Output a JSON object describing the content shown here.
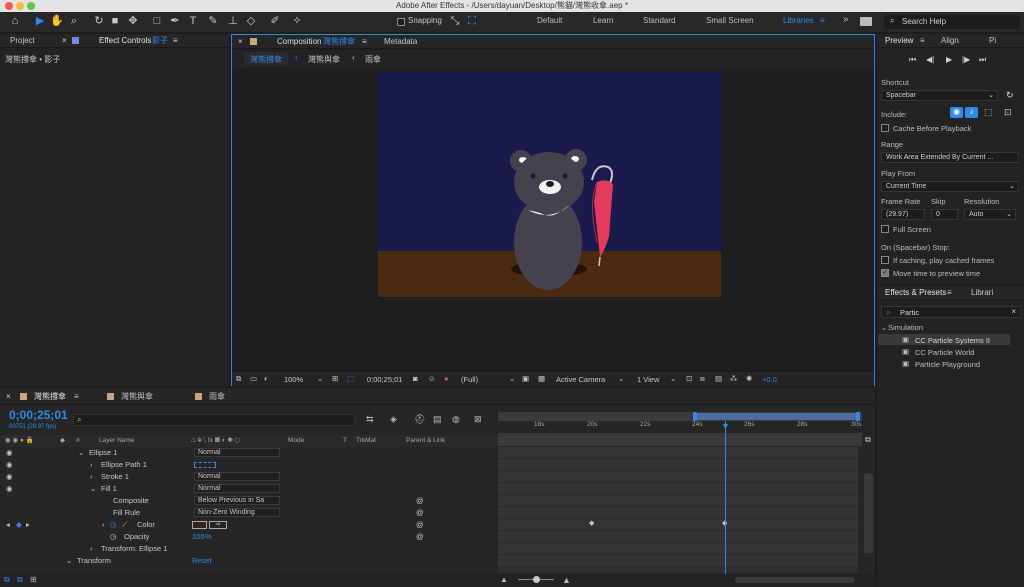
{
  "app": {
    "title": "Adobe After Effects - /Users/dayuan/Desktop/熊貓/灣熊收傘.aep *"
  },
  "toolbar": {
    "snapping_label": "Snapping",
    "workspaces": [
      "Default",
      "Learn",
      "Standard",
      "Small Screen",
      "Libraries"
    ],
    "active_workspace": "Libraries",
    "search_placeholder": "Search Help"
  },
  "left_panel": {
    "tab_project": "Project",
    "tab_effect_controls": "Effect Controls",
    "effect_controls_layer": "影子",
    "layer_path": "灣熊撐傘 • 影子"
  },
  "composition": {
    "tab_label": "Composition",
    "comp_name": "灣熊撐傘",
    "tab_metadata": "Metadata",
    "breadcrumbs": [
      "灣熊撐傘",
      "灣熊與傘",
      "雨傘"
    ],
    "footer": {
      "zoom": "100%",
      "timecode": "0;00;25;01",
      "resolution": "(Full)",
      "camera": "Active Camera",
      "view": "1 View",
      "exposure": "+0.0"
    }
  },
  "timeline": {
    "tabs": [
      "灣熊撐傘",
      "灣熊與傘",
      "雨傘"
    ],
    "timecode": "0;00;25;01",
    "frame_info": "00751 (29.97 fps)",
    "search_placeholder": "",
    "columns": {
      "layer_name": "Layer Name",
      "mode": "Mode",
      "t": "T",
      "trkmat": "TrkMat",
      "parent": "Parent & Link"
    },
    "ruler_labels": [
      "18s",
      "20s",
      "22s",
      "24s",
      "26s",
      "28s",
      "30s"
    ],
    "rows": [
      {
        "name": "Ellipse 1",
        "mode": "Normal"
      },
      {
        "name": "Ellipse Path 1",
        "mode": ""
      },
      {
        "name": "Stroke 1",
        "mode": "Normal"
      },
      {
        "name": "Fill 1",
        "mode": "Normal"
      },
      {
        "name": "Composite",
        "mode": "Below Previous in Sa"
      },
      {
        "name": "Fill Rule",
        "mode": "Non-Zero Winding"
      },
      {
        "name": "Color",
        "mode": ""
      },
      {
        "name": "Opacity",
        "value": "100",
        "unit": "%"
      },
      {
        "name": "Transform: Ellipse 1",
        "mode": ""
      },
      {
        "name": "Transform",
        "reset": "Reset"
      }
    ]
  },
  "preview": {
    "tab_preview": "Preview",
    "tab_align": "Align",
    "tab_extra": "Pi",
    "shortcut_label": "Shortcut",
    "shortcut_value": "Spacebar",
    "include_label": "Include:",
    "cache_before": "Cache Before Playback",
    "range_label": "Range",
    "range_value": "Work Area Extended By Current ...",
    "play_from_label": "Play From",
    "play_from_value": "Current Time",
    "frame_rate_label": "Frame Rate",
    "skip_label": "Skip",
    "resolution_label": "Resolution",
    "frame_rate_value": "(29.97)",
    "skip_value": "0",
    "resolution_value": "Auto",
    "full_screen": "Full Screen",
    "stop_label": "On (Spacebar) Stop:",
    "if_caching": "If caching, play cached frames",
    "move_time": "Move time to preview time"
  },
  "effects": {
    "tab_label": "Effects & Presets",
    "tab_libraries": "Librari",
    "search_value": "Partic",
    "category": "Simulation",
    "items": [
      "CC Particle Systems II",
      "CC Particle World",
      "Particle Playground"
    ]
  },
  "colors": {
    "accent": "#2d8ceb",
    "comp_bg": "#1a1a4c",
    "floor": "#4a2a10",
    "umbrella": "#e23c5a",
    "bear": "#44424c"
  }
}
